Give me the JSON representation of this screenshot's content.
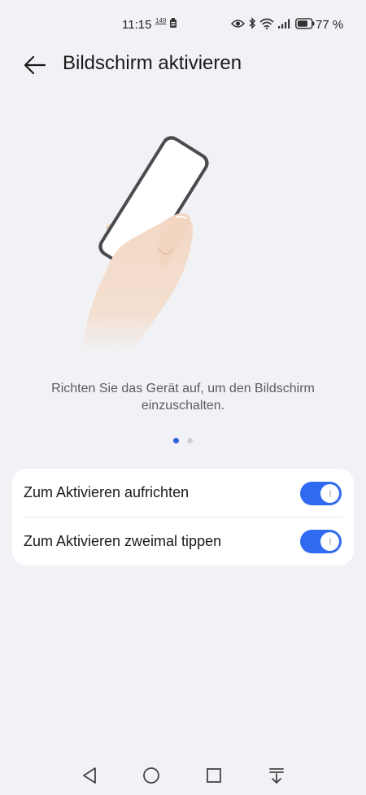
{
  "status_bar": {
    "time": "11:15",
    "netspeed_line1": "149",
    "netspeed_line2": "",
    "battery_text": "77 %",
    "icons": [
      "eye-icon",
      "bluetooth-icon",
      "wifi-icon",
      "signal-icon",
      "battery-icon"
    ],
    "battery_level": 0.77
  },
  "header": {
    "title": "Bildschirm aktivieren"
  },
  "description": "Richten Sie das Gerät auf, um den Bildschirm einzuschalten.",
  "pager": {
    "count": 2,
    "active_index": 0
  },
  "settings": [
    {
      "label": "Zum Aktivieren aufrichten",
      "enabled": true
    },
    {
      "label": "Zum Aktivieren zweimal tippen",
      "enabled": true
    }
  ],
  "colors": {
    "background": "#f1f2f6",
    "accent": "#2f6af0",
    "card": "#ffffff"
  },
  "nav_bar": {
    "buttons": [
      "back-triangle-icon",
      "home-circle-icon",
      "recents-square-icon",
      "notification-shade-icon"
    ]
  }
}
